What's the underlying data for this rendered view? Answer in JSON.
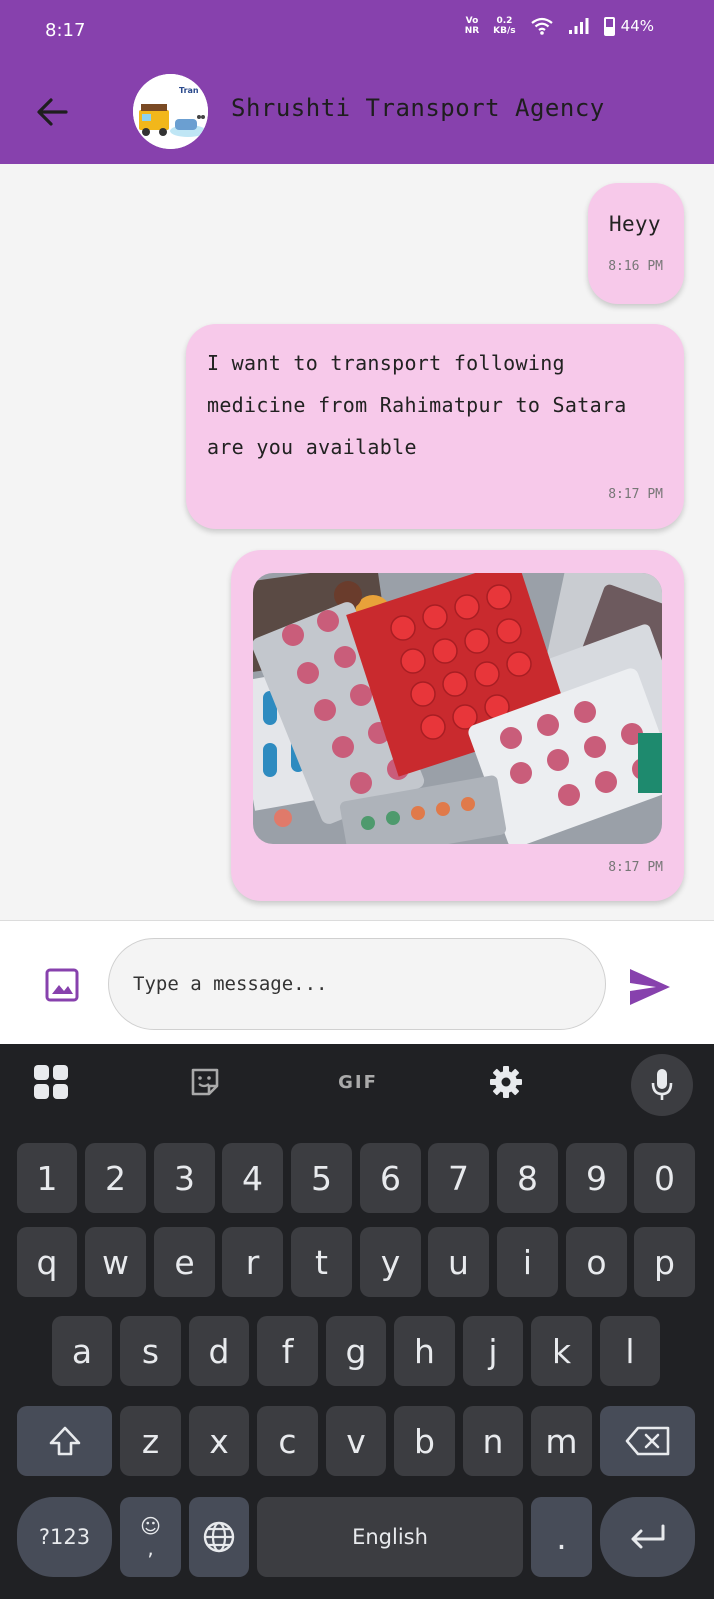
{
  "status_bar": {
    "time": "8:17",
    "volte_top": "Vo",
    "volte_bottom": "NR",
    "speed_value": "0.2",
    "speed_unit": "KB/s",
    "battery_percent": "44%",
    "battery_level": 0.44
  },
  "header": {
    "title": "Shrushti Transport Agency",
    "avatar_text": "Tran"
  },
  "messages": [
    {
      "text": "Heyy",
      "time": "8:16 PM"
    },
    {
      "text": "I want to transport following medicine from Rahimatpur to Satara are you available",
      "time": "8:17 PM"
    },
    {
      "time": "8:17 PM"
    }
  ],
  "composer": {
    "placeholder": "Type a message..."
  },
  "keyboard": {
    "toolbar_gif": "GIF",
    "numbers": [
      "1",
      "2",
      "3",
      "4",
      "5",
      "6",
      "7",
      "8",
      "9",
      "0"
    ],
    "row1": [
      "q",
      "w",
      "e",
      "r",
      "t",
      "y",
      "u",
      "i",
      "o",
      "p"
    ],
    "row2": [
      "a",
      "s",
      "d",
      "f",
      "g",
      "h",
      "j",
      "k",
      "l"
    ],
    "row3": [
      "z",
      "x",
      "c",
      "v",
      "b",
      "n",
      "m"
    ],
    "symbols_key": "?123",
    "emoji_key": "☺",
    "comma_key": ",",
    "space_label": "English",
    "period_key": "."
  },
  "colors": {
    "header": "#8741ad",
    "bubble": "#f7c9ea",
    "accent": "#8741ad"
  }
}
